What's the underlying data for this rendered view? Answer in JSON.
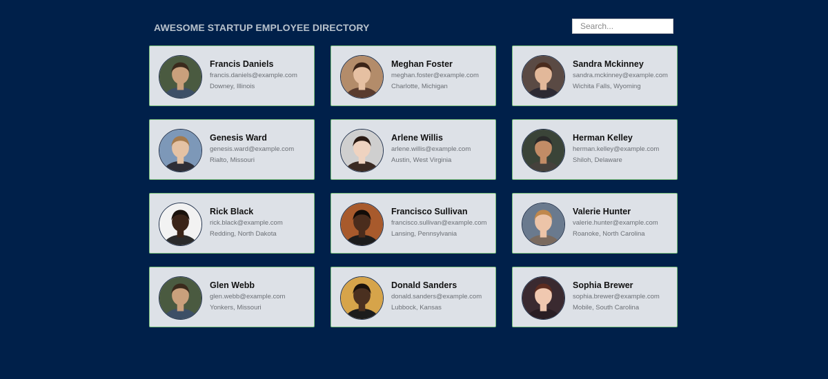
{
  "header": {
    "title": "AWESOME STARTUP EMPLOYEE DIRECTORY",
    "search_placeholder": "Search..."
  },
  "employees": [
    {
      "name": "Francis Daniels",
      "email": "francis.daniels@example.com",
      "location": "Downey, Illinois",
      "avatar": {
        "bg": "#4a5a40",
        "skin": "#c9a07c",
        "hair": "#3a2a1c",
        "shirt": "#3d4f66"
      }
    },
    {
      "name": "Meghan Foster",
      "email": "meghan.foster@example.com",
      "location": "Charlotte, Michigan",
      "avatar": {
        "bg": "#b38c6a",
        "skin": "#e6c0a2",
        "hair": "#3b2418",
        "shirt": "#5a3c2e"
      }
    },
    {
      "name": "Sandra Mckinney",
      "email": "sandra.mckinney@example.com",
      "location": "Wichita Falls, Wyoming",
      "avatar": {
        "bg": "#5a4a44",
        "skin": "#e2b89a",
        "hair": "#4a2c1e",
        "shirt": "#2d2a33"
      }
    },
    {
      "name": "Genesis Ward",
      "email": "genesis.ward@example.com",
      "location": "Rialto, Missouri",
      "avatar": {
        "bg": "#7d98b8",
        "skin": "#e4c2a4",
        "hair": "#a47a4c",
        "shirt": "#2e2e36"
      }
    },
    {
      "name": "Arlene Willis",
      "email": "arlene.willis@example.com",
      "location": "Austin, West Virginia",
      "avatar": {
        "bg": "#cfcfcf",
        "skin": "#efd3c0",
        "hair": "#2b1a12",
        "shirt": "#3a2a22"
      }
    },
    {
      "name": "Herman Kelley",
      "email": "herman.kelley@example.com",
      "location": "Shiloh, Delaware",
      "avatar": {
        "bg": "#3a4438",
        "skin": "#c28c66",
        "hair": "#2a2a2a",
        "shirt": "#45413c"
      }
    },
    {
      "name": "Rick Black",
      "email": "rick.black@example.com",
      "location": "Redding, North Dakota",
      "avatar": {
        "bg": "#f2f2f2",
        "skin": "#3a2418",
        "hair": "#1a120c",
        "shirt": "#2a2a2a"
      }
    },
    {
      "name": "Francisco Sullivan",
      "email": "francisco.sullivan@example.com",
      "location": "Lansing, Pennsylvania",
      "avatar": {
        "bg": "#a85a2c",
        "skin": "#4a2c1c",
        "hair": "#120c08",
        "shirt": "#1c1c1c"
      }
    },
    {
      "name": "Valerie Hunter",
      "email": "valerie.hunter@example.com",
      "location": "Roanoke, North Carolina",
      "avatar": {
        "bg": "#6a7a8e",
        "skin": "#ecc4a8",
        "hair": "#c0884c",
        "shirt": "#7a6a5e"
      }
    },
    {
      "name": "Glen Webb",
      "email": "glen.webb@example.com",
      "location": "Yonkers, Missouri",
      "avatar": {
        "bg": "#4a5a40",
        "skin": "#c9a07c",
        "hair": "#3a2a1c",
        "shirt": "#3d4f66"
      }
    },
    {
      "name": "Donald Sanders",
      "email": "donald.sanders@example.com",
      "location": "Lubbock, Kansas",
      "avatar": {
        "bg": "#d6a44a",
        "skin": "#4a3020",
        "hair": "#1a120c",
        "shirt": "#1c1c1c"
      }
    },
    {
      "name": "Sophia Brewer",
      "email": "sophia.brewer@example.com",
      "location": "Mobile, South Carolina",
      "avatar": {
        "bg": "#3a2a30",
        "skin": "#f0c8b0",
        "hair": "#5c2c20",
        "shirt": "#2a1e24"
      }
    }
  ]
}
